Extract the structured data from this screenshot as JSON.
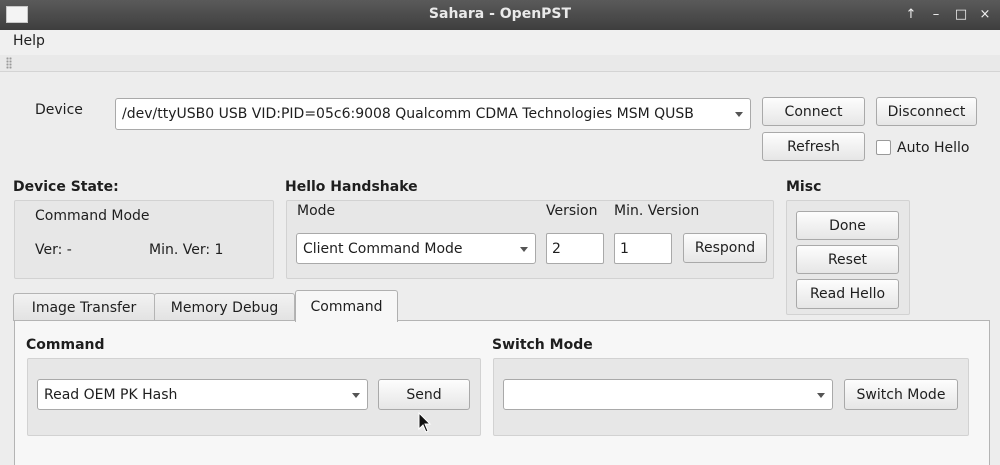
{
  "window": {
    "title": "Sahara - OpenPST",
    "controls": [
      "↑",
      "–",
      "□",
      "×"
    ]
  },
  "menu": [
    "Help"
  ],
  "device": {
    "label": "Device",
    "selected": "/dev/ttyUSB0 USB VID:PID=05c6:9008  Qualcomm CDMA Technologies MSM QUSB",
    "connect": "Connect",
    "disconnect": "Disconnect",
    "refresh": "Refresh",
    "auto_hello": "Auto Hello",
    "auto_hello_checked": false
  },
  "device_state": {
    "title": "Device State:",
    "mode": "Command Mode",
    "ver": "Ver: -",
    "min_ver": "Min. Ver: 1"
  },
  "hello": {
    "title": "Hello Handshake",
    "mode_label": "Mode",
    "version_label": "Version",
    "min_version_label": "Min. Version",
    "mode_value": "Client Command Mode",
    "version_value": "2",
    "min_version_value": "1",
    "respond": "Respond"
  },
  "misc": {
    "title": "Misc",
    "done": "Done",
    "reset": "Reset",
    "read_hello": "Read Hello"
  },
  "tabs": [
    {
      "label": "Image Transfer",
      "active": false
    },
    {
      "label": "Memory Debug",
      "active": false
    },
    {
      "label": "Command",
      "active": true
    }
  ],
  "command": {
    "title": "Command",
    "selected": "Read OEM PK Hash",
    "send": "Send"
  },
  "switch_mode": {
    "title": "Switch Mode",
    "selected": "",
    "button": "Switch Mode"
  }
}
